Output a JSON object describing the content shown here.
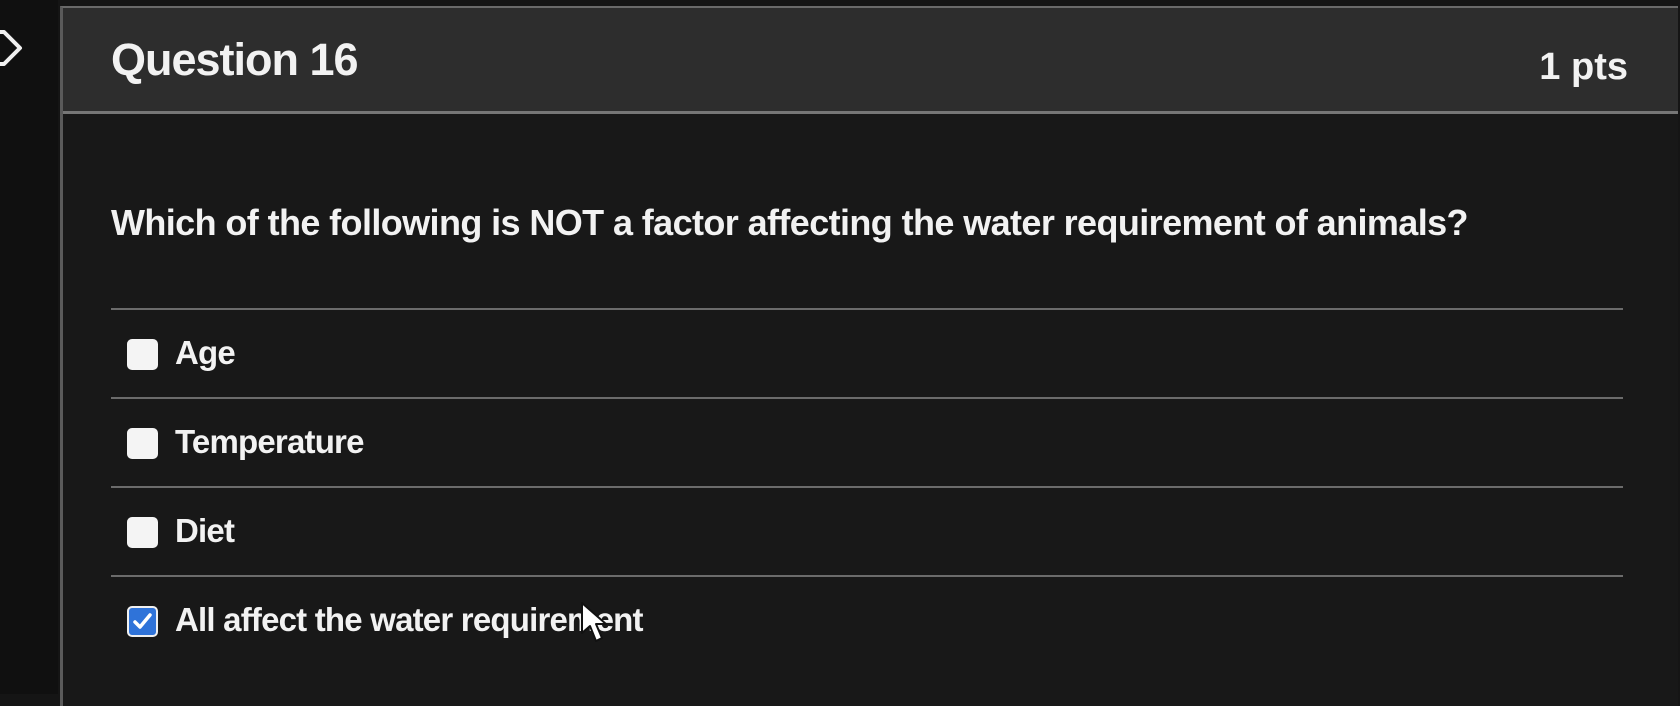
{
  "question": {
    "title": "Question 16",
    "points": "1 pts",
    "text": "Which of the following is NOT a factor affecting the water requirement of animals?"
  },
  "answers": [
    {
      "label": "Age",
      "checked": false
    },
    {
      "label": "Temperature",
      "checked": false
    },
    {
      "label": "Diet",
      "checked": false
    },
    {
      "label": "All affect the water requirement",
      "checked": true
    }
  ],
  "icons": {
    "collapse": "chevron-right-icon",
    "checkmark": "checkmark-icon",
    "cursor": "mouse-pointer-icon"
  },
  "colors": {
    "checked_box": "#2f73d9",
    "header_background": "#2d2d2d",
    "body_background": "#181818"
  }
}
